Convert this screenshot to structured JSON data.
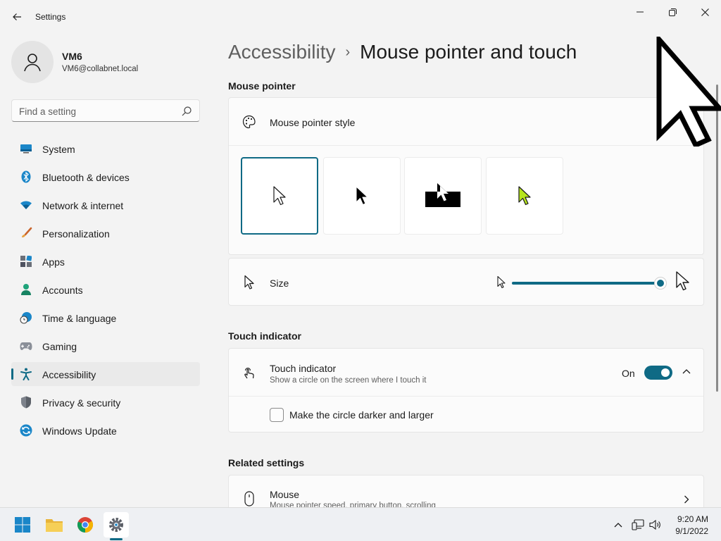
{
  "window": {
    "title": "Settings"
  },
  "user": {
    "name": "VM6",
    "email": "VM6@collabnet.local"
  },
  "search": {
    "placeholder": "Find a setting"
  },
  "sidebar": {
    "items": [
      {
        "label": "System",
        "icon": "system-icon"
      },
      {
        "label": "Bluetooth & devices",
        "icon": "bluetooth-icon"
      },
      {
        "label": "Network & internet",
        "icon": "network-icon"
      },
      {
        "label": "Personalization",
        "icon": "brush-icon"
      },
      {
        "label": "Apps",
        "icon": "apps-icon"
      },
      {
        "label": "Accounts",
        "icon": "accounts-icon"
      },
      {
        "label": "Time & language",
        "icon": "clock-globe-icon"
      },
      {
        "label": "Gaming",
        "icon": "gamepad-icon"
      },
      {
        "label": "Accessibility",
        "icon": "accessibility-icon",
        "active": true
      },
      {
        "label": "Privacy & security",
        "icon": "shield-icon"
      },
      {
        "label": "Windows Update",
        "icon": "update-icon"
      }
    ]
  },
  "breadcrumb": {
    "parent": "Accessibility",
    "separator": "›",
    "current": "Mouse pointer and touch"
  },
  "mouse_pointer": {
    "section_title": "Mouse pointer",
    "style_label": "Mouse pointer style",
    "styles": [
      "white",
      "black",
      "inverted",
      "custom"
    ],
    "selected_style": "white",
    "size_label": "Size",
    "size_level": 1.0
  },
  "touch": {
    "section_title": "Touch indicator",
    "label": "Touch indicator",
    "description": "Show a circle on the screen where I touch it",
    "state": "On",
    "enabled": true,
    "darker_label": "Make the circle darker and larger",
    "darker_checked": false
  },
  "related": {
    "section_title": "Related settings",
    "mouse_label": "Mouse",
    "mouse_description": "Mouse pointer speed, primary button, scrolling"
  },
  "taskbar": {
    "time": "9:20 AM",
    "date": "9/1/2022"
  },
  "colors": {
    "accent": "#0f6a85",
    "background": "#f3f3f3",
    "card": "#fbfbfb",
    "custom_pointer": "#b6e51d"
  }
}
